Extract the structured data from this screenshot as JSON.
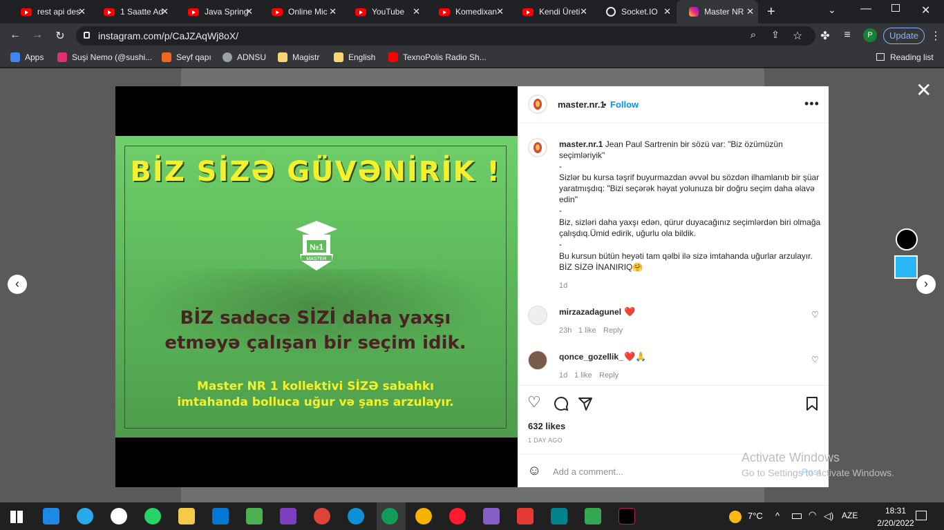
{
  "browser": {
    "tabs": [
      {
        "title": "rest api des",
        "icon": "youtube-icon",
        "close": "✕"
      },
      {
        "title": "1 Saatte Ad",
        "icon": "youtube-icon",
        "close": "✕"
      },
      {
        "title": "Java Spring",
        "icon": "youtube-icon",
        "close": "✕"
      },
      {
        "title": "Online Mic",
        "icon": "youtube-icon",
        "close": "✕"
      },
      {
        "title": "YouTube",
        "icon": "youtube-icon",
        "close": "✕"
      },
      {
        "title": "Komedixan",
        "icon": "youtube-icon",
        "close": "✕"
      },
      {
        "title": "Kendi Üreti",
        "icon": "youtube-icon",
        "close": "✕"
      },
      {
        "title": "Socket.IO",
        "icon": "socketio-icon",
        "close": "✕"
      },
      {
        "title": "Master NR",
        "icon": "instagram-icon",
        "close": "✕"
      }
    ],
    "new_tab": "+",
    "url": "instagram.com/p/CaJZAqWj8oX/",
    "update_label": "Update",
    "profile_initial": "P",
    "bookmarks": [
      {
        "label": "Apps",
        "icon": "apps-grid-icon"
      },
      {
        "label": "Suşi Nemo (@sushi...",
        "icon": "instagram-icon"
      },
      {
        "label": "Seyf qapı",
        "icon": "t-icon"
      },
      {
        "label": "ADNSU",
        "icon": "globe-icon"
      },
      {
        "label": "Magistr",
        "icon": "folder-icon"
      },
      {
        "label": "English",
        "icon": "folder-icon"
      },
      {
        "label": "TexnoPolis Radio Sh...",
        "icon": "youtube-icon"
      }
    ],
    "reading_list": "Reading list"
  },
  "poster": {
    "headline": "BİZ SİZƏ GÜVƏNİRİK !",
    "logo_text": "MASTER",
    "logo_number": "№1",
    "line1": "BİZ sadəcə SİZİ daha yaxşı",
    "line2": "etməyə çalışan bir seçim idik.",
    "line3": "Master NR 1 kollektivi SİZƏ sabahkı",
    "line4": "imtahanda bolluca uğur və şans arzulayır."
  },
  "post": {
    "username": "master.nr.1",
    "separator": "•",
    "follow_label": "Follow",
    "more": "•••",
    "caption_user": "master.nr.1",
    "caption_lines": [
      "Jean Paul Sartrenin bir sözü var: \"Biz özümüzün seçimləriyik\"",
      "-",
      "Sizlər bu kursa təşrif buyurmazdan əvvəl bu sözdən ilhamlanıb bir şüar yaratmışdıq: \"Bizi seçərək həyat yolunuza bir doğru seçim daha əlavə edin\"",
      "-",
      "Biz, sizləri daha yaxşı edən, qürur duyacağınız seçimlərdən biri olmağa çalışdıq.Ümid edirik, uğurlu ola bildik.",
      "-",
      "Bu kursun bütün heyəti tam qəlbi ilə sizə imtahanda uğurlar arzulayır. BİZ SİZƏ İNANIRIQ🤗"
    ],
    "caption_age": "1d",
    "comments": [
      {
        "user": "mirzazadagunel",
        "text": "❤️",
        "age": "23h",
        "likes": "1 like",
        "reply": "Reply"
      },
      {
        "user": "qonce_gozellik_",
        "text": "❤️🙏",
        "age": "1d",
        "likes": "1 like",
        "reply": "Reply"
      }
    ],
    "likes": "632 likes",
    "posted": "1 DAY AGO",
    "add_comment_placeholder": "Add a comment...",
    "post_label": "Post"
  },
  "overlay": {
    "close": "✕",
    "prev": "‹",
    "next": "›",
    "watermark_line1": "Activate Windows",
    "watermark_line2": "Go to Settings to activate Windows."
  },
  "taskbar": {
    "weather": "7°C",
    "language": "AZE",
    "time": "18:31",
    "date": "2/20/2022"
  },
  "colors": {
    "accent_blue": "#0095f6",
    "poster_yellow": "#f4f12a",
    "poster_green": "#5fbb5c",
    "poster_text_dark": "#4a2323"
  }
}
